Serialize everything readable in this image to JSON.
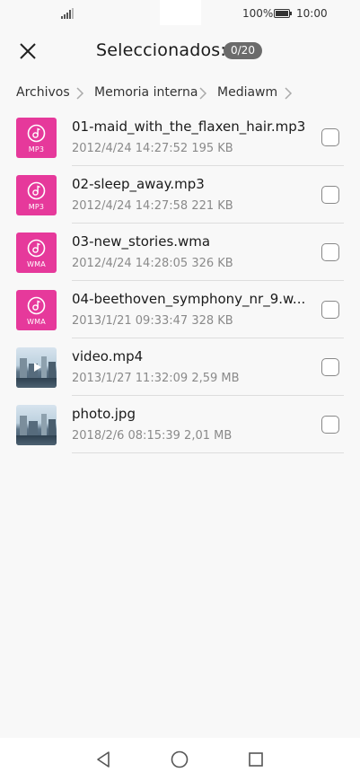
{
  "status_bar": {
    "battery_percent": "100%",
    "time": "10:00",
    "icons": [
      "signal-icon",
      "battery-icon"
    ]
  },
  "header": {
    "title": "Seleccionados:",
    "selected_count": "0/20",
    "close_icon": "close-icon"
  },
  "breadcrumb": {
    "items": [
      "Archivos",
      "Memoria interna",
      "Mediawm"
    ],
    "separator_icon": "chevron-right-icon"
  },
  "files": [
    {
      "name": "01-maid_with_the_flaxen_hair.mp3",
      "date": "2012/4/24 14:27:52",
      "size": "195 KB",
      "type": "audio",
      "ext": "MP3",
      "checked": false
    },
    {
      "name": "02-sleep_away.mp3",
      "date": "2012/4/24 14:27:58",
      "size": "221 KB",
      "type": "audio",
      "ext": "MP3",
      "checked": false
    },
    {
      "name": "03-new_stories.wma",
      "date": "2012/4/24 14:28:05",
      "size": "326 KB",
      "type": "audio",
      "ext": "WMA",
      "checked": false
    },
    {
      "name": "04-beethoven_symphony_nr_9.w...",
      "date": "2013/1/21 09:33:47",
      "size": "328 KB",
      "type": "audio",
      "ext": "WMA",
      "checked": false
    },
    {
      "name": "video.mp4",
      "date": "2013/1/27 11:32:09",
      "size": "2,59 MB",
      "type": "video",
      "checked": false
    },
    {
      "name": "photo.jpg",
      "date": "2018/2/6 08:15:39",
      "size": "2,01 MB",
      "type": "image",
      "checked": false
    }
  ],
  "nav_bar": {
    "back_icon": "back-triangle-icon",
    "home_icon": "home-circle-icon",
    "recents_icon": "recents-square-icon"
  },
  "colors": {
    "accent": "#e6399b",
    "background": "#f8f8f8",
    "badge": "#6b6b6b",
    "secondary_text": "#8a8a8a"
  }
}
